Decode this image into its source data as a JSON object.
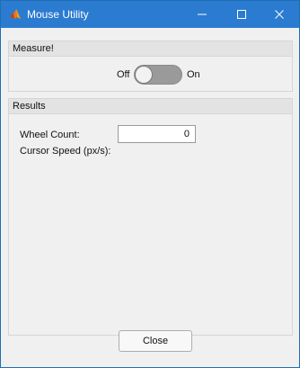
{
  "window": {
    "title": "Mouse Utility",
    "controls": {
      "minimize": "—",
      "maximize": "☐",
      "close": "✕"
    },
    "icon": "matlab-icon"
  },
  "measure_panel": {
    "title": "Measure!",
    "switch": {
      "off_label": "Off",
      "on_label": "On",
      "state": "Off"
    }
  },
  "results_panel": {
    "title": "Results",
    "wheel_count": {
      "label": "Wheel Count:",
      "value": "0"
    },
    "cursor_speed": {
      "label": "Cursor Speed (px/s):"
    }
  },
  "footer": {
    "close_label": "Close"
  },
  "colors": {
    "titlebar": "#2b7bd0",
    "panel_header": "#e3e3e3",
    "switch_track": "#9a9a9a",
    "background": "#f0f0f0"
  }
}
